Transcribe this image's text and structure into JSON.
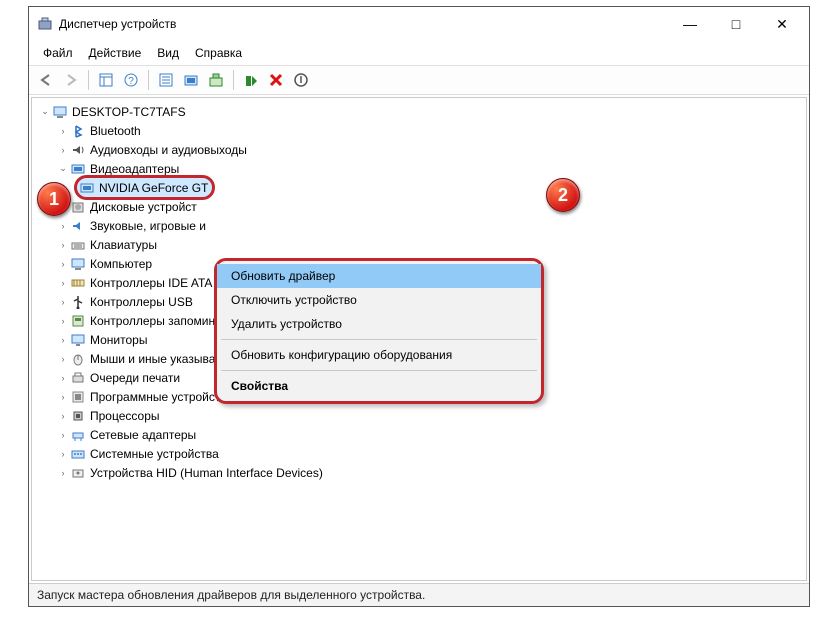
{
  "window": {
    "title": "Диспетчер устройств",
    "min": "—",
    "max": "□",
    "close": "✕"
  },
  "menu": {
    "file": "Файл",
    "action": "Действие",
    "view": "Вид",
    "help": "Справка"
  },
  "tree": {
    "root": "DESKTOP-TC7TAFS",
    "items": [
      {
        "label": "Bluetooth",
        "icon": "bt"
      },
      {
        "label": "Аудиовходы и аудиовыходы",
        "icon": "aud"
      },
      {
        "label": "Видеоадаптеры",
        "icon": "vid",
        "expanded": true
      },
      {
        "label": "NVIDIA GeForce GT",
        "icon": "vid",
        "child": true,
        "selected": true
      },
      {
        "label": "Дисковые устройст",
        "icon": "disk"
      },
      {
        "label": "Звуковые, игровые и",
        "icon": "snd"
      },
      {
        "label": "Клавиатуры",
        "icon": "kb"
      },
      {
        "label": "Компьютер",
        "icon": "pc"
      },
      {
        "label": "Контроллеры IDE ATA",
        "icon": "ide"
      },
      {
        "label": "Контроллеры USB",
        "icon": "usb"
      },
      {
        "label": "Контроллеры запоминающих устройств",
        "icon": "stor"
      },
      {
        "label": "Мониторы",
        "icon": "mon"
      },
      {
        "label": "Мыши и иные указывающие устройства",
        "icon": "mouse"
      },
      {
        "label": "Очереди печати",
        "icon": "print"
      },
      {
        "label": "Программные устройства",
        "icon": "sw"
      },
      {
        "label": "Процессоры",
        "icon": "cpu"
      },
      {
        "label": "Сетевые адаптеры",
        "icon": "net"
      },
      {
        "label": "Системные устройства",
        "icon": "sys"
      },
      {
        "label": "Устройства HID (Human Interface Devices)",
        "icon": "hid"
      }
    ]
  },
  "context": {
    "update": "Обновить драйвер",
    "disable": "Отключить устройство",
    "remove": "Удалить устройство",
    "scan": "Обновить конфигурацию оборудования",
    "props": "Свойства"
  },
  "status": "Запуск мастера обновления драйверов для выделенного устройства.",
  "markers": {
    "one": "1",
    "two": "2"
  }
}
